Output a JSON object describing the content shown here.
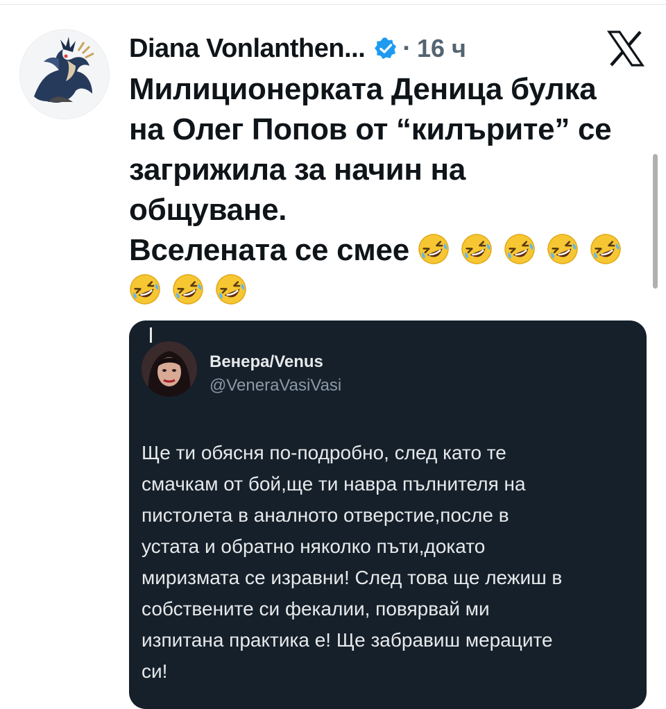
{
  "post": {
    "author_name": "Diana Vonlanthen...",
    "separator": "·",
    "time": "16 ч",
    "lines": [
      "Милиционерката Деница булка",
      "на Олег Попов от “килърите” се",
      "загрижила за начин на",
      "общуване.",
      "Вселената се смее"
    ],
    "emoji_name": "rolling-on-floor-laughing",
    "emoji_count": 8
  },
  "quote": {
    "name": "Венера/Venus",
    "handle": "@VeneraVasiVasi",
    "body_lines": [
      "Ще ти обясня по-подробно, след като те",
      "смачкам от бой,ще ти навра пълнителя на",
      "пистолета в аналното отверстие,после в",
      "устата и обратно няколко пъти,докато",
      "миризмата се изравни! След това ще лежиш в",
      "собствените си фекалии, повярвай ми",
      "изпитана практика е! Ще забравиш мераците",
      "си!"
    ]
  },
  "icons": {
    "verified": "verified-badge-icon",
    "platform": "x-logo-icon"
  },
  "colors": {
    "verified_blue": "#1d9bf0",
    "quote_background": "#15202b"
  }
}
